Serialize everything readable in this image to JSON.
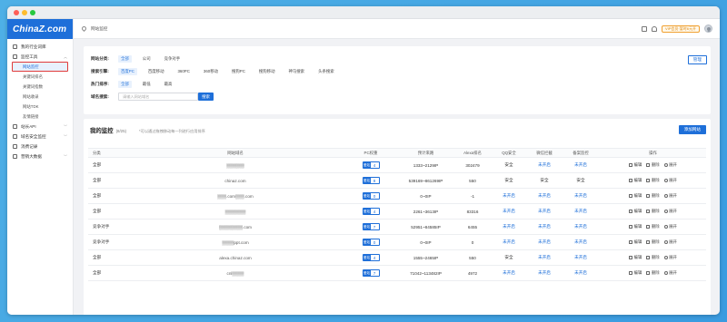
{
  "app": {
    "logo": "ChinaZ.com"
  },
  "sidebar": {
    "items": [
      {
        "label": "我的行业词库",
        "icon": "folder-icon"
      },
      {
        "label": "监控工具",
        "icon": "monitor-icon",
        "expanded": true,
        "children": [
          {
            "label": "网站监控",
            "active": true
          },
          {
            "label": "关键词排名"
          },
          {
            "label": "关键词指数"
          },
          {
            "label": "网站收录"
          },
          {
            "label": "网站TDK"
          },
          {
            "label": "友情链接"
          }
        ]
      },
      {
        "label": "站长API",
        "icon": "api-icon"
      },
      {
        "label": "域名安全监控",
        "icon": "shield-icon"
      },
      {
        "label": "消费记录",
        "icon": "receipt-icon"
      },
      {
        "label": "营销大数据",
        "icon": "chart-icon"
      }
    ]
  },
  "topbar": {
    "breadcrumb": "网站监控",
    "vip": "VIP会员·暂时6元开"
  },
  "filters": {
    "category": {
      "label": "网站分类:",
      "options": [
        "全部",
        "公司",
        "竞争对手"
      ],
      "selected": 0
    },
    "engine": {
      "label": "搜索引擎:",
      "options": [
        "百度PC",
        "百度移动",
        "360PC",
        "360移动",
        "搜狗PC",
        "搜狗移动",
        "神马搜索",
        "头条搜索"
      ],
      "selected": 0
    },
    "sort": {
      "label": "热门排序:",
      "options": [
        "全部",
        "最低",
        "最高"
      ],
      "selected": 0
    },
    "search": {
      "label": "域名搜索:",
      "placeholder": "请输入网站域名",
      "button": "搜索"
    },
    "manage_button": "管理"
  },
  "monitor": {
    "title": "我的监控",
    "count": "(8/25)",
    "tip": "*可以通过拖拽移动每一列进行应用排序",
    "add_button": "添加网站",
    "columns": [
      "分类",
      "网站域名",
      "PC权重",
      "预计来路",
      "Alexa排名",
      "QQ安全",
      "微信拦截",
      "备案监控",
      "操作"
    ],
    "pc_label": "爱站",
    "rows": [
      {
        "category": "全部",
        "domain": "▒▒▒▒▒▒",
        "pc": "4",
        "traffic": "1333~2129IP",
        "alexa": "302479",
        "qq": "安全",
        "wx": "未开启",
        "beian": "未开启"
      },
      {
        "category": "全部",
        "domain": "chinaz.com",
        "pc": "8",
        "traffic": "539169~861269IP",
        "alexa": "550",
        "qq": "安全",
        "wx": "安全",
        "beian": "安全"
      },
      {
        "category": "全部",
        "domain": "▒▒▒.com▒▒▒.com",
        "pc": "0",
        "traffic": "0~0IP",
        "alexa": "-1",
        "qq": "未开启",
        "wx": "未开启",
        "beian": "未开启"
      },
      {
        "category": "全部",
        "domain": "▒▒▒▒▒▒▒",
        "pc": "4",
        "traffic": "2261~3613IP",
        "alexa": "83316",
        "qq": "未开启",
        "wx": "未开启",
        "beian": "未开启"
      },
      {
        "category": "竞争对手",
        "domain": "▒▒▒▒▒▒▒▒.com",
        "pc": "7",
        "traffic": "52951~84585IP",
        "alexa": "6455",
        "qq": "未开启",
        "wx": "未开启",
        "beian": "未开启"
      },
      {
        "category": "竞争对手",
        "domain": "▒▒▒▒ppt.com",
        "pc": "0",
        "traffic": "0~0IP",
        "alexa": "0",
        "qq": "未开启",
        "wx": "未开启",
        "beian": "未开启"
      },
      {
        "category": "全部",
        "domain": "alexa.chinaz.com",
        "pc": "4",
        "traffic": "1555~2465IP",
        "alexa": "550",
        "qq": "安全",
        "wx": "未开启",
        "beian": "未开启"
      },
      {
        "category": "全部",
        "domain": "cnl▒▒▒▒",
        "pc": "7",
        "traffic": "71042~113482IP",
        "alexa": "4972",
        "qq": "未开启",
        "wx": "未开启",
        "beian": "未开启"
      }
    ],
    "ops": {
      "edit": "编辑",
      "delete": "删除",
      "expand": "展开"
    }
  }
}
